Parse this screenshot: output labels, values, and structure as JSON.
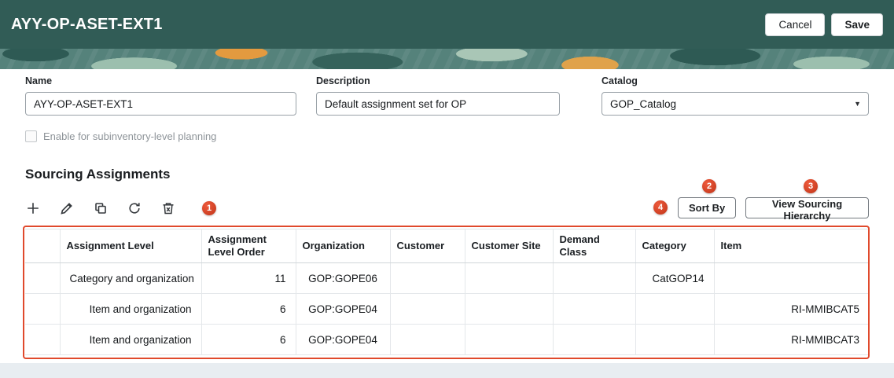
{
  "colors": {
    "topbar_teal": "#315c56",
    "annotation_red": "#d94228",
    "page_bg": "#e8edf1"
  },
  "header": {
    "title": "AYY-OP-ASET-EXT1",
    "cancel_label": "Cancel",
    "save_label": "Save"
  },
  "form": {
    "name": {
      "label": "Name",
      "value": "AYY-OP-ASET-EXT1"
    },
    "description": {
      "label": "Description",
      "value": "Default assignment set for OP"
    },
    "catalog": {
      "label": "Catalog",
      "value": "GOP_Catalog"
    },
    "checkbox_label": "Enable for subinventory-level planning",
    "checkbox_checked": false
  },
  "section": {
    "title": "Sourcing Assignments"
  },
  "toolbar": {
    "icons": [
      "add-icon",
      "edit-icon",
      "duplicate-icon",
      "refresh-icon",
      "delete-icon"
    ],
    "sort_by_label": "Sort By",
    "view_hierarchy_label": "View Sourcing Hierarchy"
  },
  "annotations": {
    "badge1": "1",
    "badge2": "2",
    "badge3": "3",
    "badge4": "4"
  },
  "table": {
    "headers": [
      "",
      "Assignment Level",
      "Assignment Level Order",
      "Organization",
      "Customer",
      "Customer Site",
      "Demand Class",
      "Category",
      "Item"
    ],
    "rows": [
      [
        "",
        "Category and organization",
        "11",
        "GOP:GOPE06",
        "",
        "",
        "",
        "CatGOP14",
        ""
      ],
      [
        "",
        "Item and organization",
        "6",
        "GOP:GOPE04",
        "",
        "",
        "",
        "",
        "RI-MMIBCAT5"
      ],
      [
        "",
        "Item and organization",
        "6",
        "GOP:GOPE04",
        "",
        "",
        "",
        "",
        "RI-MMIBCAT3"
      ]
    ]
  }
}
